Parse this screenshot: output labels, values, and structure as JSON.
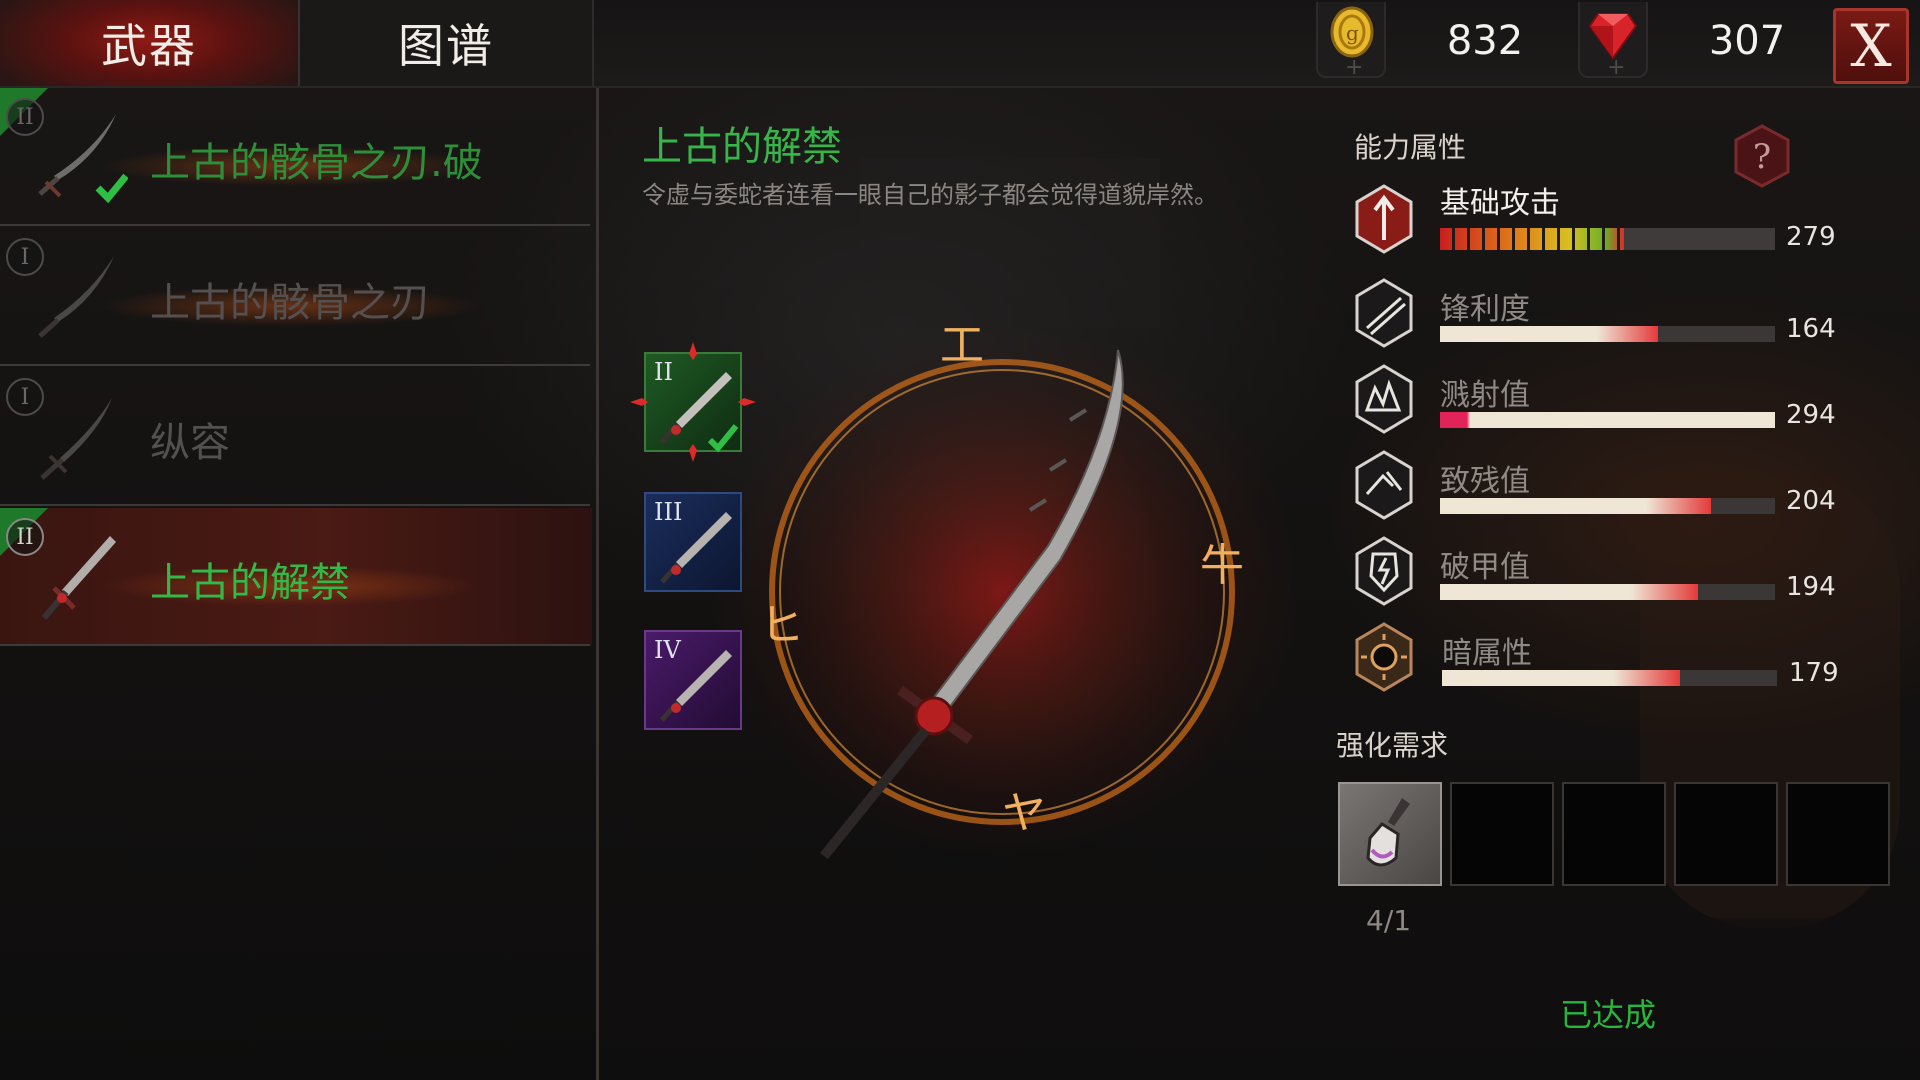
{
  "tabs": [
    {
      "label": "武器",
      "active": true
    },
    {
      "label": "图谱",
      "active": false
    }
  ],
  "currency": {
    "coin_value": "832",
    "gem_value": "307",
    "coin_icon": "gold-coin-icon",
    "gem_icon": "red-gem-icon"
  },
  "close_label": "X",
  "weapons": [
    {
      "tier": "II",
      "name": "上古的骸骨之刃.破",
      "owned_check": true,
      "selected": false,
      "name_color": "#2e8f3a"
    },
    {
      "tier": "I",
      "name": "上古的骸骨之刃",
      "owned_check": false,
      "selected": false,
      "name_color": "#545050"
    },
    {
      "tier": "I",
      "name": "纵容",
      "owned_check": false,
      "selected": false,
      "name_color": "#545050"
    },
    {
      "tier": "II",
      "name": "上古的解禁",
      "owned_check": false,
      "selected": true,
      "name_color": "#33b948"
    }
  ],
  "detail": {
    "title": "上古的解禁",
    "description": "令虚与委蛇者连看一眼自己的影子都会觉得道貌岸然。",
    "tier_cards": [
      {
        "label": "II",
        "color": "green",
        "active": true
      },
      {
        "label": "III",
        "color": "blue",
        "active": false
      },
      {
        "label": "IV",
        "color": "purple",
        "active": false
      }
    ]
  },
  "stats": {
    "title": "能力属性",
    "help_label": "?",
    "items": [
      {
        "name": "基础攻击",
        "value": "279",
        "fill": 0.55,
        "icon": "attack-icon"
      },
      {
        "name": "锋利度",
        "value": "164",
        "fill": 0.65,
        "icon": "sharpness-icon"
      },
      {
        "name": "溅射值",
        "value": "294",
        "fill": 1.0,
        "icon": "splash-icon"
      },
      {
        "name": "致残值",
        "value": "204",
        "fill": 0.81,
        "icon": "cripple-icon"
      },
      {
        "name": "破甲值",
        "value": "194",
        "fill": 0.77,
        "icon": "armor-break-icon"
      },
      {
        "name": "暗属性",
        "value": "179",
        "fill": 0.71,
        "icon": "dark-element-icon"
      }
    ]
  },
  "requirements": {
    "title": "强化需求",
    "count": "4/1",
    "slot_item_icon": "potion-icon",
    "status": "已达成"
  },
  "colors": {
    "accent_green": "#33b948",
    "accent_red": "#a8352c",
    "bar_red": "#e53b3b"
  }
}
